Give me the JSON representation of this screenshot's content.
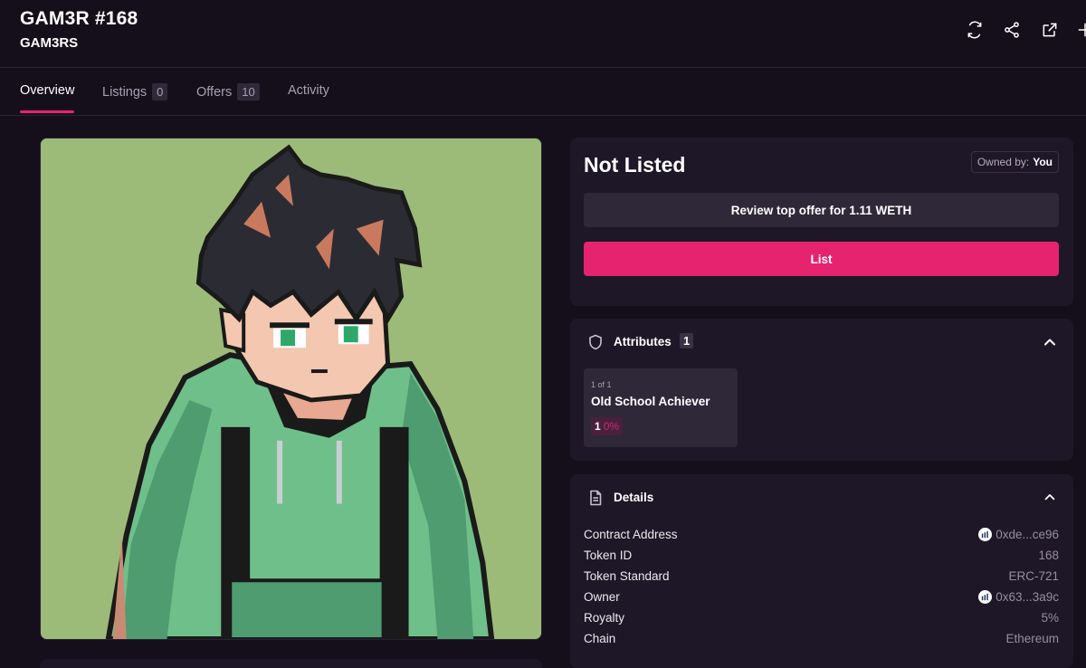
{
  "header": {
    "title": "GAM3R #168",
    "collection": "GAM3RS",
    "icons": [
      "refresh-icon",
      "share-icon",
      "external-link-icon",
      "more-icon"
    ]
  },
  "tabs": [
    {
      "label": "Overview",
      "active": true
    },
    {
      "label": "Listings",
      "count": "0"
    },
    {
      "label": "Offers",
      "count": "10"
    },
    {
      "label": "Activity"
    }
  ],
  "listing": {
    "status": "Not Listed",
    "owned_by_label": "Owned by:",
    "owned_by_value": "You",
    "offer_button": "Review top offer for 1.11 WETH",
    "list_button": "List"
  },
  "attributes": {
    "title": "Attributes",
    "count": "1",
    "items": [
      {
        "rarity": "1 of 1",
        "name": "Old School Achiever",
        "count": "1",
        "percent": "0%"
      }
    ]
  },
  "details": {
    "title": "Details",
    "rows": [
      {
        "label": "Contract Address",
        "value": "0xde...ce96",
        "icon": true
      },
      {
        "label": "Token ID",
        "value": "168"
      },
      {
        "label": "Token Standard",
        "value": "ERC-721"
      },
      {
        "label": "Owner",
        "value": "0x63...3a9c",
        "icon": true
      },
      {
        "label": "Royalty",
        "value": "5%"
      },
      {
        "label": "Chain",
        "value": "Ethereum"
      }
    ]
  },
  "colors": {
    "background": "#150f1c",
    "panel": "#1e1727",
    "accent": "#e6236f",
    "art_background": "#9dbb78",
    "hoodie": "#6fbf8a"
  }
}
